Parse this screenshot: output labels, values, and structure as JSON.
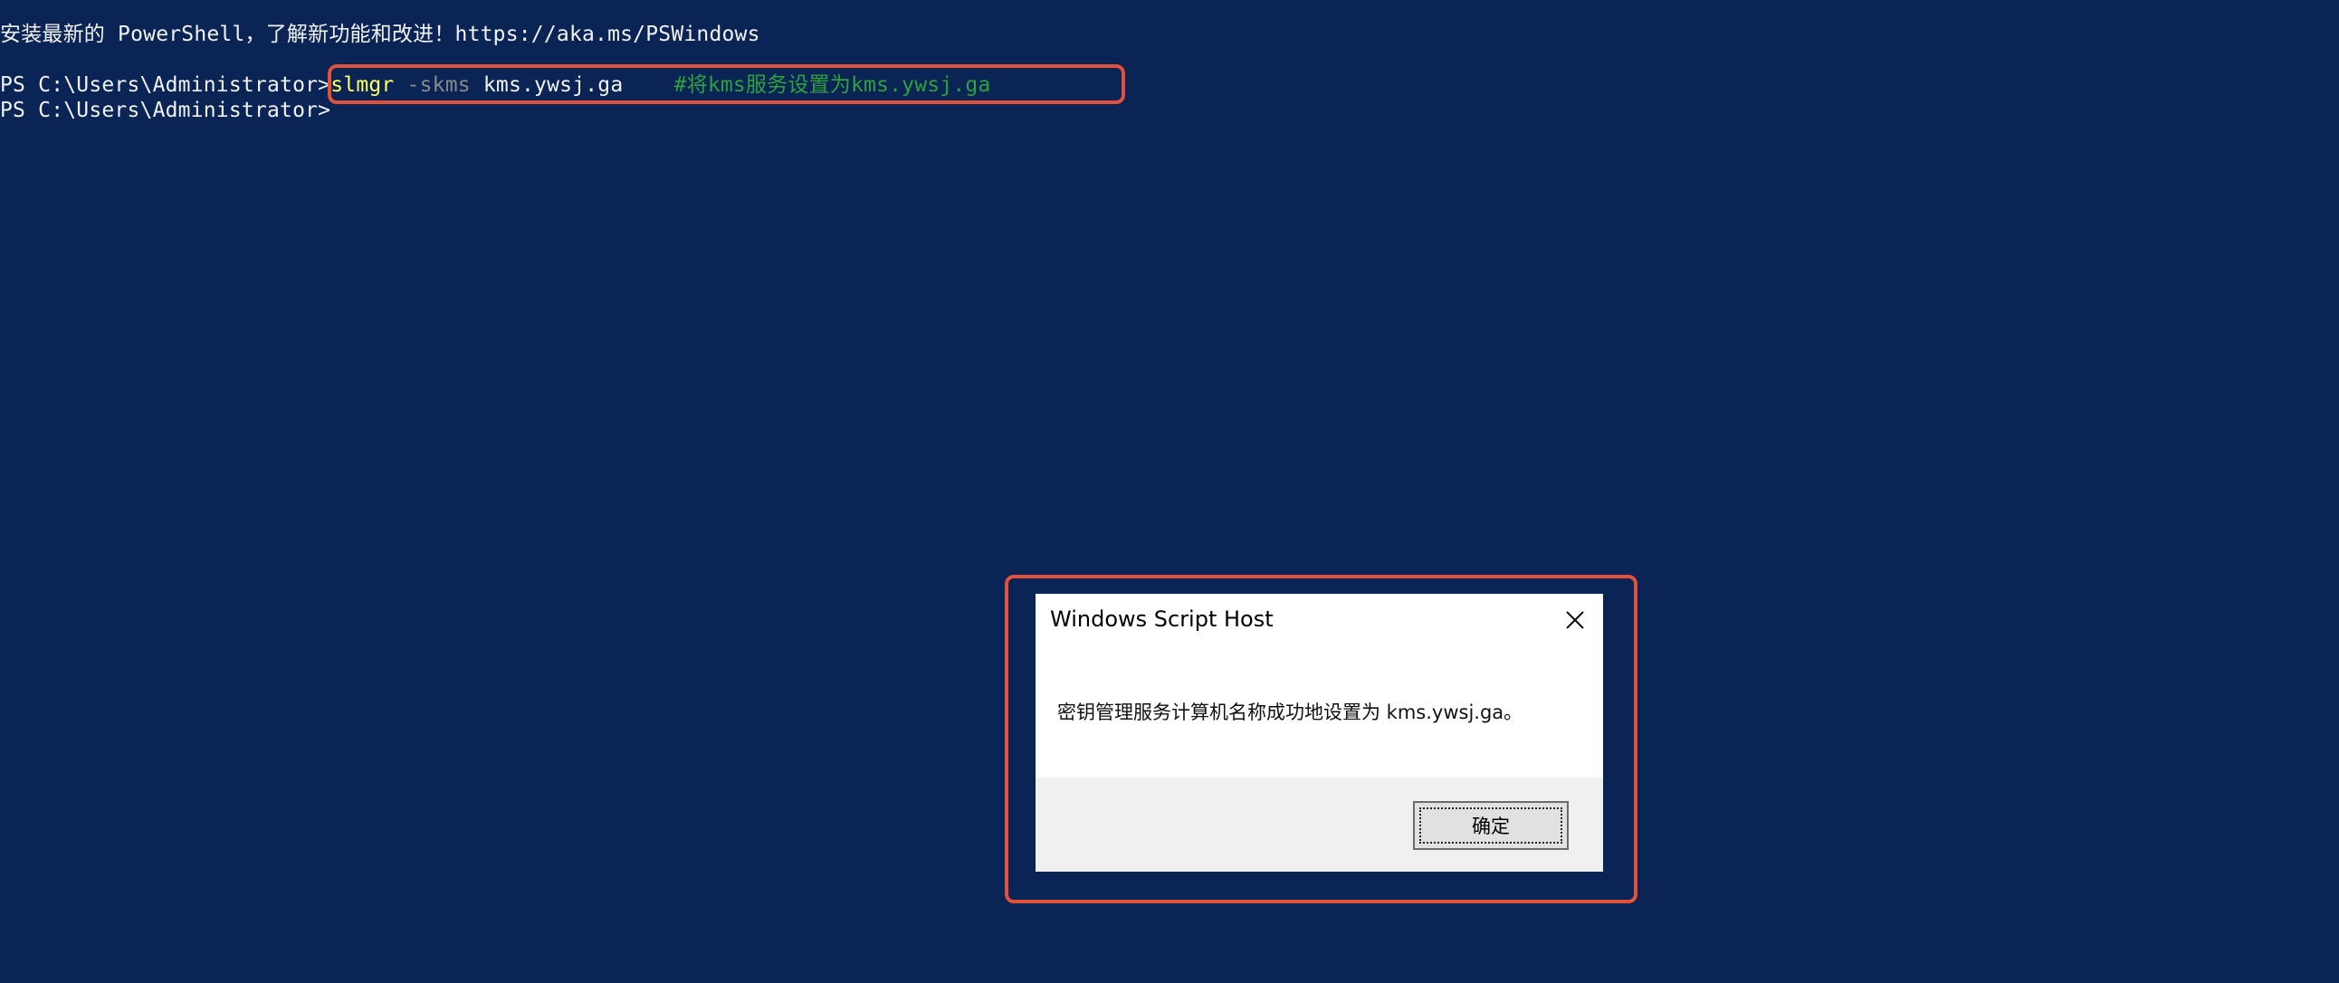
{
  "terminal": {
    "banner": "安装最新的 PowerShell，了解新功能和改进！https://aka.ms/PSWindows",
    "prompt": "PS C:\\Users\\Administrator>",
    "command": {
      "verb": "slmgr",
      "param": "-skms",
      "arg": "kms.ywsj.ga",
      "comment": "#将kms服务设置为kms.ywsj.ga"
    },
    "colors": {
      "background": "#0a2456",
      "text": "#f2f2f2",
      "verb": "#ffff60",
      "param": "#8a8a8a",
      "comment": "#2fa13b"
    }
  },
  "dialog": {
    "title": "Windows Script Host",
    "message": "密钥管理服务计算机名称成功地设置为 kms.ywsj.ga。",
    "ok_label": "确定",
    "close_icon": "close-icon"
  },
  "annotations": {
    "highlight_color": "#e2513a"
  }
}
